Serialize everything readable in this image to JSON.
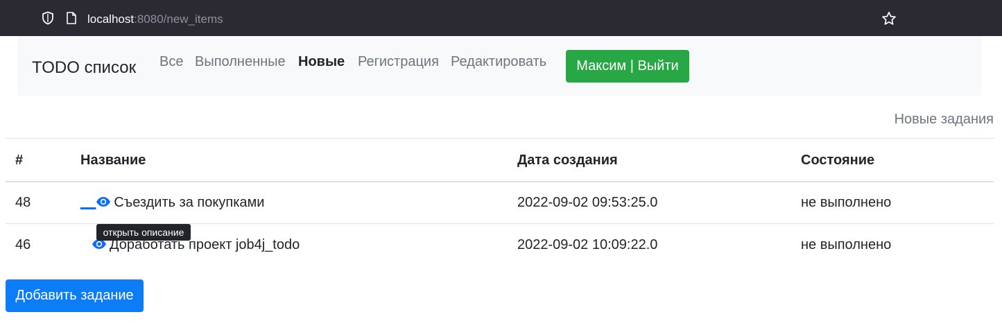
{
  "browser": {
    "url_host": "localhost",
    "url_rest": ":8080/new_items"
  },
  "navbar": {
    "brand": "TODO список",
    "links": [
      {
        "label": "Все"
      },
      {
        "label": "Выполненные"
      },
      {
        "label": "Новые",
        "active": true
      },
      {
        "label": "Регистрация"
      },
      {
        "label": "Редактировать"
      }
    ],
    "user_button": "Максим | Выйти"
  },
  "subtitle": "Новые задания",
  "table": {
    "headers": [
      "#",
      "Название",
      "Дата создания",
      "Состояние"
    ],
    "rows": [
      {
        "id": "48",
        "name": "Съездить за покупками",
        "created": "2022-09-02 09:53:25.0",
        "status": "не выполнено"
      },
      {
        "id": "46",
        "name": "Доработать проект job4j_todo",
        "created": "2022-09-02 10:09:22.0",
        "status": "не выполнено"
      }
    ]
  },
  "tooltip": "открыть описание",
  "add_button": "Добавить задание",
  "icons": {
    "shield": "shield-icon",
    "page": "page-icon",
    "star": "bookmark-star-icon",
    "eye": "eye-icon"
  },
  "colors": {
    "browser_bar": "#2b2a33",
    "navbar_bg": "#f8f9fa",
    "success": "#28a745",
    "primary": "#0d7df7",
    "link": "#0d6efd"
  }
}
